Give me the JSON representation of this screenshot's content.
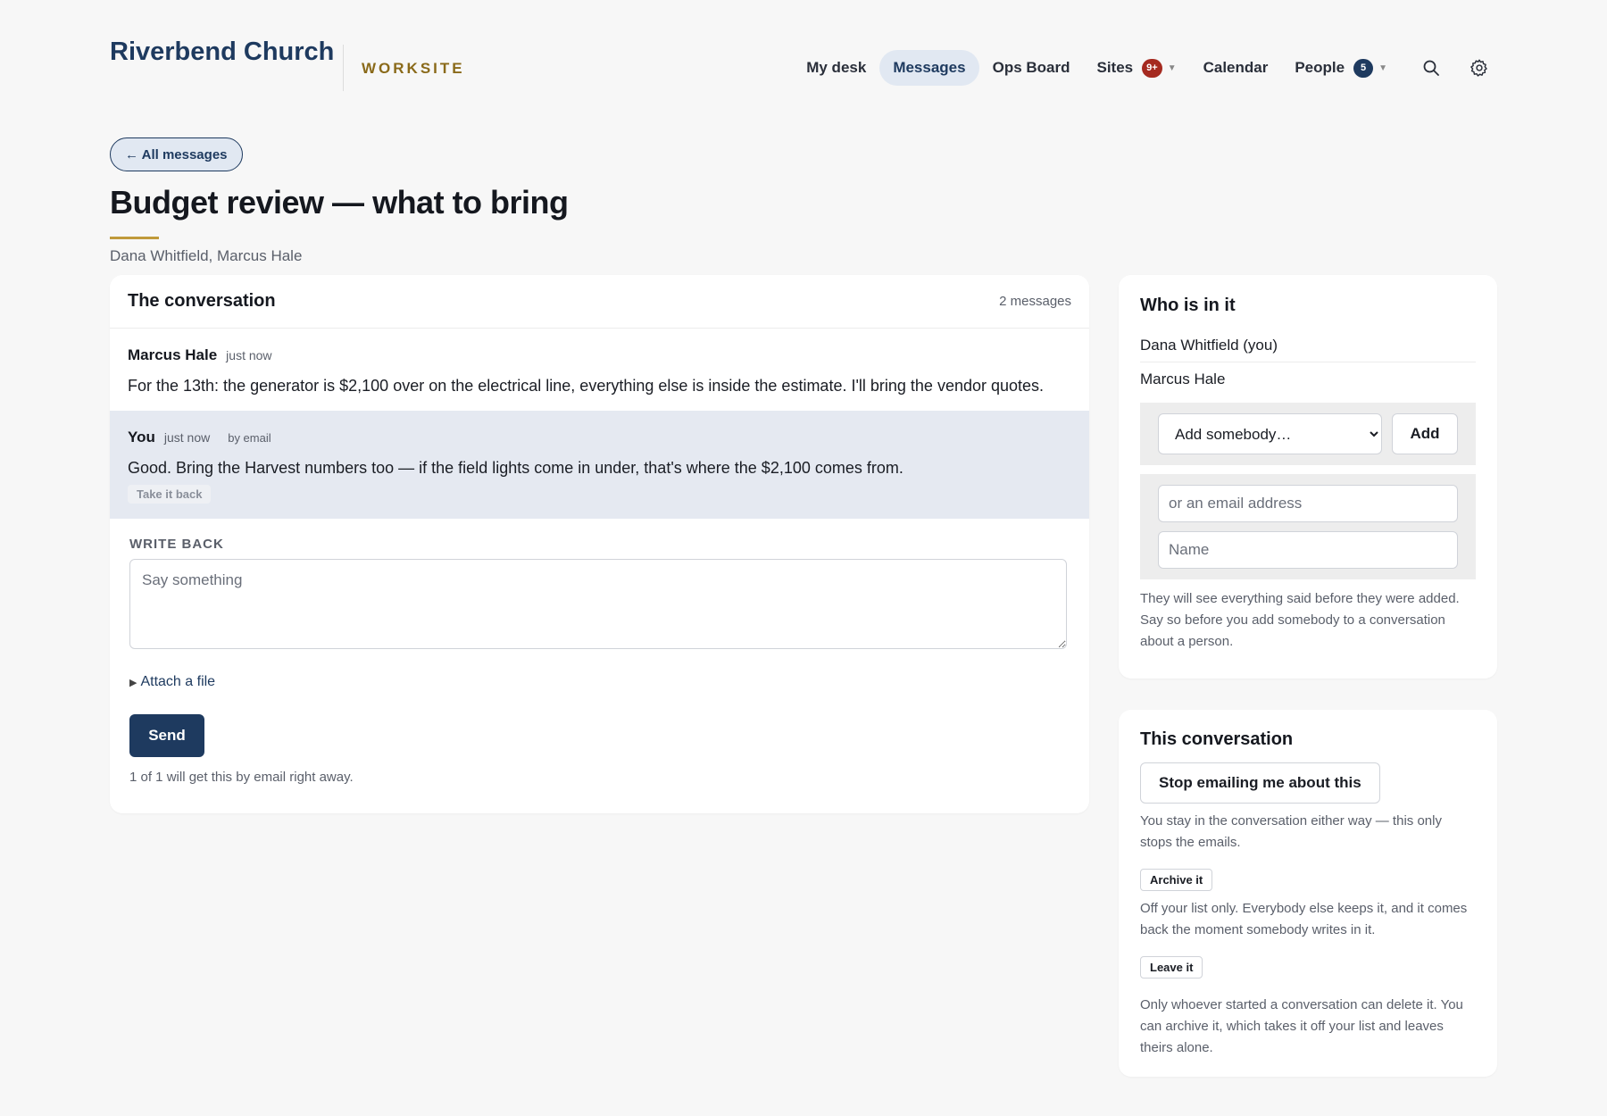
{
  "header": {
    "brand": "Riverbend Church",
    "brand_sub": "WORKSITE",
    "nav": {
      "my_desk": "My desk",
      "messages": "Messages",
      "ops_board": "Ops Board",
      "sites": "Sites",
      "sites_badge": "9+",
      "calendar": "Calendar",
      "people": "People",
      "people_badge": "5"
    },
    "icons": [
      "search-icon",
      "gear-icon"
    ]
  },
  "back_label": "← All messages",
  "page_title": "Budget review — what to bring",
  "participants_line": "Dana Whitfield, Marcus Hale",
  "conversation": {
    "title": "The conversation",
    "count": "2 messages",
    "messages": [
      {
        "author": "Marcus Hale",
        "time": "just now",
        "via": "",
        "body": "For the 13th: the generator is $2,100 over on the electrical line, everything else is inside the estimate. I'll bring the vendor quotes."
      },
      {
        "author": "You",
        "time": "just now",
        "via": "by email",
        "body": "Good. Bring the Harvest numbers too — if the field lights come in under, that's where the $2,100 comes from.",
        "retract_label": "Take it back"
      }
    ],
    "write": {
      "label": "WRITE BACK",
      "placeholder": "Say something",
      "attach_label": "Attach a file",
      "send_label": "Send",
      "note": "1 of 1 will get this by email right away."
    }
  },
  "who": {
    "title": "Who is in it",
    "people": [
      "Dana Whitfield (you)",
      "Marcus Hale"
    ],
    "add_select": "Add somebody…",
    "add_button": "Add",
    "email_placeholder": "or an email address",
    "name_placeholder": "Name",
    "note": "They will see everything said before they were added. Say so before you add somebody to a conversation about a person."
  },
  "this_conversation": {
    "title": "This conversation",
    "stop_label": "Stop emailing me about this",
    "stop_note": "You stay in the conversation either way — this only stops the emails.",
    "archive_label": "Archive it",
    "archive_note": "Off your list only. Everybody else keeps it, and it comes back the moment somebody writes in it.",
    "leave_label": "Leave it",
    "delete_note": "Only whoever started a conversation can delete it. You can archive it, which takes it off your list and leaves theirs alone."
  },
  "colors": {
    "brand": "#1e3a5f",
    "accent_gold": "#c09a3a",
    "badge_red": "#a52a20",
    "own_message_bg": "#e5e9f1"
  }
}
